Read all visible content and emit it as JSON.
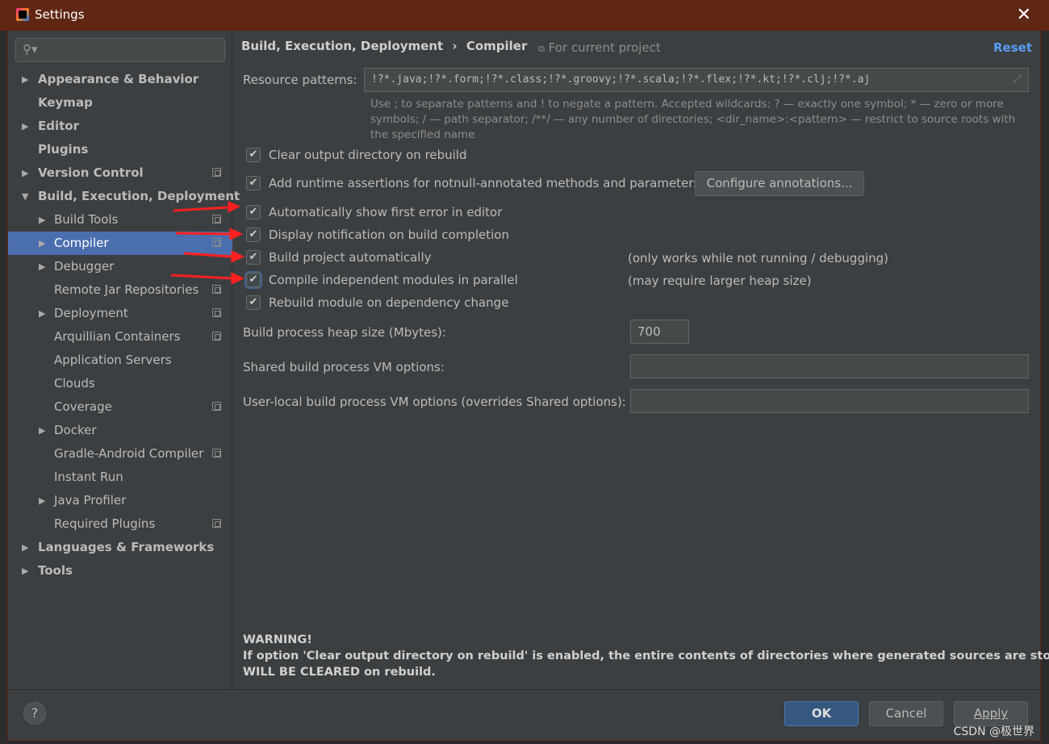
{
  "window": {
    "title": "Settings",
    "close_icon": "close-icon"
  },
  "sidebar": {
    "search_placeholder": "",
    "items": [
      {
        "label": "Appearance & Behavior",
        "level": 0,
        "arrow": "right",
        "bold": true
      },
      {
        "label": "Keymap",
        "level": 0,
        "bold": true
      },
      {
        "label": "Editor",
        "level": 0,
        "arrow": "right",
        "bold": true
      },
      {
        "label": "Plugins",
        "level": 0,
        "bold": true
      },
      {
        "label": "Version Control",
        "level": 0,
        "arrow": "right",
        "bold": true,
        "project": true
      },
      {
        "label": "Build, Execution, Deployment",
        "level": 0,
        "arrow": "down",
        "bold": true
      },
      {
        "label": "Build Tools",
        "level": 1,
        "arrow": "right",
        "project": true
      },
      {
        "label": "Compiler",
        "level": 1,
        "arrow": "right",
        "project": true,
        "selected": true
      },
      {
        "label": "Debugger",
        "level": 1,
        "arrow": "right"
      },
      {
        "label": "Remote Jar Repositories",
        "level": 1,
        "project": true
      },
      {
        "label": "Deployment",
        "level": 1,
        "arrow": "right",
        "project": true
      },
      {
        "label": "Arquillian Containers",
        "level": 1,
        "project": true
      },
      {
        "label": "Application Servers",
        "level": 1
      },
      {
        "label": "Clouds",
        "level": 1
      },
      {
        "label": "Coverage",
        "level": 1,
        "project": true
      },
      {
        "label": "Docker",
        "level": 1,
        "arrow": "right"
      },
      {
        "label": "Gradle-Android Compiler",
        "level": 1,
        "project": true
      },
      {
        "label": "Instant Run",
        "level": 1
      },
      {
        "label": "Java Profiler",
        "level": 1,
        "arrow": "right"
      },
      {
        "label": "Required Plugins",
        "level": 1,
        "project": true
      },
      {
        "label": "Languages & Frameworks",
        "level": 0,
        "arrow": "right",
        "bold": true
      },
      {
        "label": "Tools",
        "level": 0,
        "arrow": "right",
        "bold": true
      }
    ]
  },
  "header": {
    "breadcrumb_parent": "Build, Execution, Deployment",
    "breadcrumb_sep": "›",
    "breadcrumb_current": "Compiler",
    "scope": "For current project",
    "reset": "Reset"
  },
  "resource": {
    "label": "Resource patterns:",
    "value": "!?*.java;!?*.form;!?*.class;!?*.groovy;!?*.scala;!?*.flex;!?*.kt;!?*.clj;!?*.aj",
    "hint": "Use ; to separate patterns and ! to negate a pattern. Accepted wildcards: ? — exactly one symbol; * — zero or more symbols; / — path separator; /**/ — any number of directories; <dir_name>:<pattern> — restrict to source roots with the specified name"
  },
  "options": [
    {
      "label": "Clear output directory on rebuild",
      "checked": true
    },
    {
      "label": "Add runtime assertions for notnull-annotated methods and parameters",
      "checked": true
    },
    {
      "label": "Automatically show first error in editor",
      "checked": true
    },
    {
      "label": "Display notification on build completion",
      "checked": true
    },
    {
      "label": "Build project automatically",
      "checked": true,
      "note": "(only works while not running / debugging)"
    },
    {
      "label": "Compile independent modules in parallel",
      "checked": true,
      "note": "(may require larger heap size)"
    },
    {
      "label": "Rebuild module on dependency change",
      "checked": true
    }
  ],
  "configure_annotations": "Configure annotations...",
  "heap": {
    "label": "Build process heap size (Mbytes):",
    "value": "700"
  },
  "shared_vm": {
    "label": "Shared build process VM options:",
    "value": ""
  },
  "user_vm": {
    "label": "User-local build process VM options (overrides Shared options):",
    "value": ""
  },
  "warning": {
    "title": "WARNING!",
    "line1": "If option 'Clear output directory on rebuild' is enabled, the entire contents of directories where generated sources are stored",
    "line2": "WILL BE CLEARED on rebuild."
  },
  "footer": {
    "help": "?",
    "ok": "OK",
    "cancel": "Cancel",
    "apply": "Apply"
  },
  "watermark": "CSDN @极世界",
  "colors": {
    "titlebar": "#5f2713",
    "selection": "#4b6eaf",
    "ok_button": "#365880",
    "link": "#589df6",
    "annotation_arrow": "#ff2020"
  }
}
